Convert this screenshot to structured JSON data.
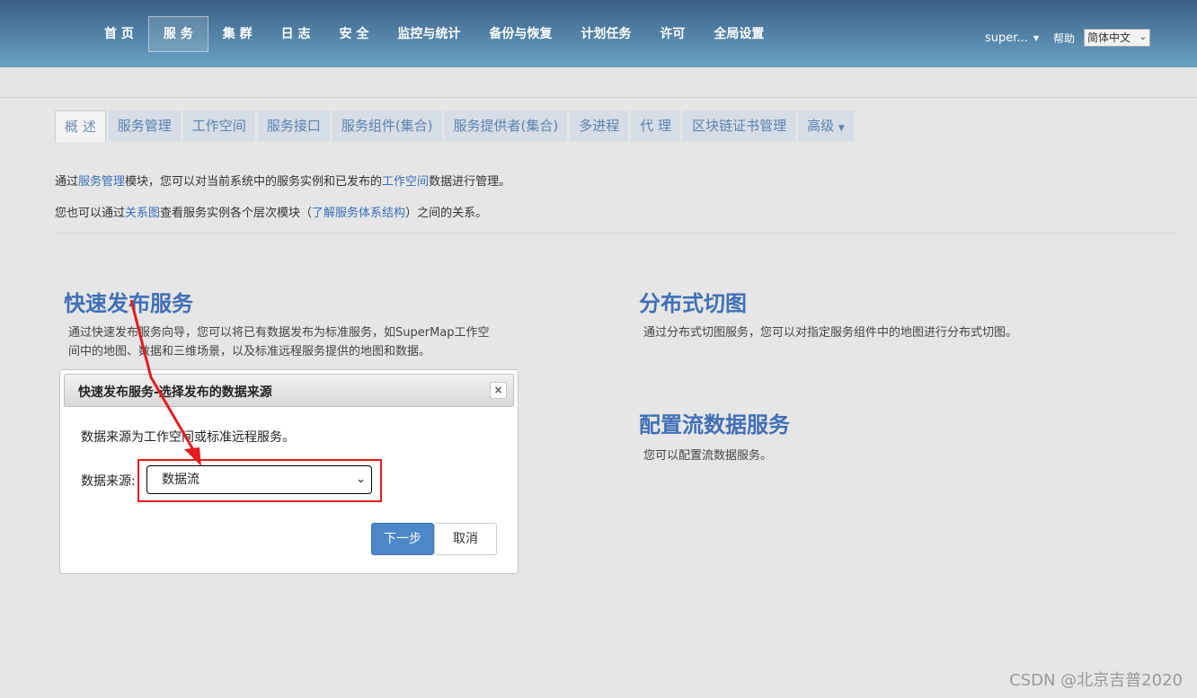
{
  "nav": {
    "items": [
      {
        "label": "首 页"
      },
      {
        "label": "服 务"
      },
      {
        "label": "集 群"
      },
      {
        "label": "日 志"
      },
      {
        "label": "安 全"
      },
      {
        "label": "监控与统计"
      },
      {
        "label": "备份与恢复"
      },
      {
        "label": "计划任务"
      },
      {
        "label": "许可"
      },
      {
        "label": "全局设置"
      }
    ],
    "active_index": 1
  },
  "user": {
    "name": "super...",
    "help": "帮助",
    "language": "简体中文"
  },
  "tabs": [
    {
      "label": "概 述"
    },
    {
      "label": "服务管理"
    },
    {
      "label": "工作空间"
    },
    {
      "label": "服务接口"
    },
    {
      "label": "服务组件(集合)"
    },
    {
      "label": "服务提供者(集合)"
    },
    {
      "label": "多进程"
    },
    {
      "label": "代 理"
    },
    {
      "label": "区块链证书管理"
    },
    {
      "label": "高级"
    }
  ],
  "intro": {
    "line1": {
      "p1": "通过",
      "link1": "服务管理",
      "p2": "模块，您可以对当前系统中的服务实例和已发布的",
      "link2": "工作空间",
      "p3": "数据进行管理。"
    },
    "line2": {
      "p1": "您也可以通过",
      "link1": "关系图",
      "p2": "查看服务实例各个层次模块（",
      "link2": "了解服务体系结构",
      "p3": "）之间的关系。"
    }
  },
  "sections": {
    "quick_publish": {
      "title": "快速发布服务",
      "desc_line1": "通过快速发布服务向导，您可以将已有数据发布为标准服务，如SuperMap工作空",
      "desc_line2": "间中的地图、数据和三维场景，以及标准远程服务提供的地图和数据。"
    },
    "distributed_tile": {
      "title": "分布式切图",
      "desc": "通过分布式切图服务，您可以对指定服务组件中的地图进行分布式切图。"
    },
    "stream_service": {
      "title": "配置流数据服务",
      "desc": "您可以配置流数据服务。"
    }
  },
  "dialog": {
    "title": "快速发布服务-选择发布的数据来源",
    "text": "数据来源为工作空间或标准远程服务。",
    "field_label": "数据来源:",
    "selected": "数据流",
    "next": "下一步",
    "cancel": "取消"
  },
  "watermark": "CSDN @北京吉普2020",
  "colors": {
    "accent": "#4070b7",
    "highlight": "#e31d1d",
    "primary_button": "#4b87c9"
  }
}
